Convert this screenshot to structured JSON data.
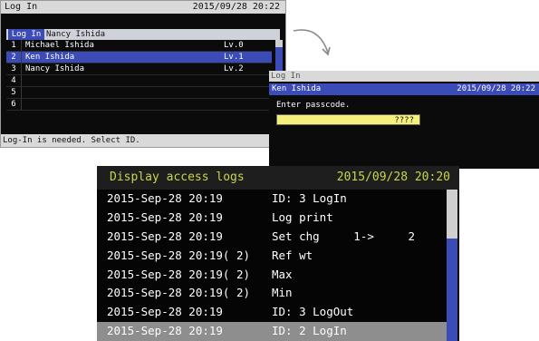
{
  "login_screen": {
    "title": "Log In",
    "datetime": "2015/09/28  20:22",
    "tabs": [
      "Log In",
      "Nancy Ishida"
    ],
    "users": [
      {
        "num": "1",
        "name": "Michael Ishida",
        "level": "Lv.0"
      },
      {
        "num": "2",
        "name": "Ken Ishida",
        "level": "Lv.1"
      },
      {
        "num": "3",
        "name": "Nancy Ishida",
        "level": "Lv.2"
      },
      {
        "num": "4",
        "name": "",
        "level": ""
      },
      {
        "num": "5",
        "name": "",
        "level": ""
      },
      {
        "num": "6",
        "name": "",
        "level": ""
      }
    ],
    "status": "Log-In is needed. Select ID."
  },
  "passcode_screen": {
    "title": "Log In",
    "user": "Ken Ishida",
    "datetime": "2015/09/28  20:22",
    "prompt": "Enter passcode.",
    "value": "????"
  },
  "log_screen": {
    "title": "Display access logs",
    "datetime": "2015/09/28  20:20",
    "entries": [
      {
        "time": "2015-Sep-28 20:19",
        "action": "ID: 3 LogIn"
      },
      {
        "time": "2015-Sep-28 20:19",
        "action": "Log print"
      },
      {
        "time": "2015-Sep-28 20:19",
        "action": "Set chg     1->     2"
      },
      {
        "time": "2015-Sep-28 20:19( 2)",
        "action": "Ref wt"
      },
      {
        "time": "2015-Sep-28 20:19( 2)",
        "action": "Max"
      },
      {
        "time": "2015-Sep-28 20:19( 2)",
        "action": "Min"
      },
      {
        "time": "2015-Sep-28 20:19",
        "action": "ID: 3 LogOut"
      },
      {
        "time": "2015-Sep-28 20:19",
        "action": "ID: 2 LogIn"
      }
    ]
  },
  "colors": {
    "selection": "#3b4bb7",
    "header_text": "#c8d64a",
    "passcode_field": "#f6f07a"
  }
}
